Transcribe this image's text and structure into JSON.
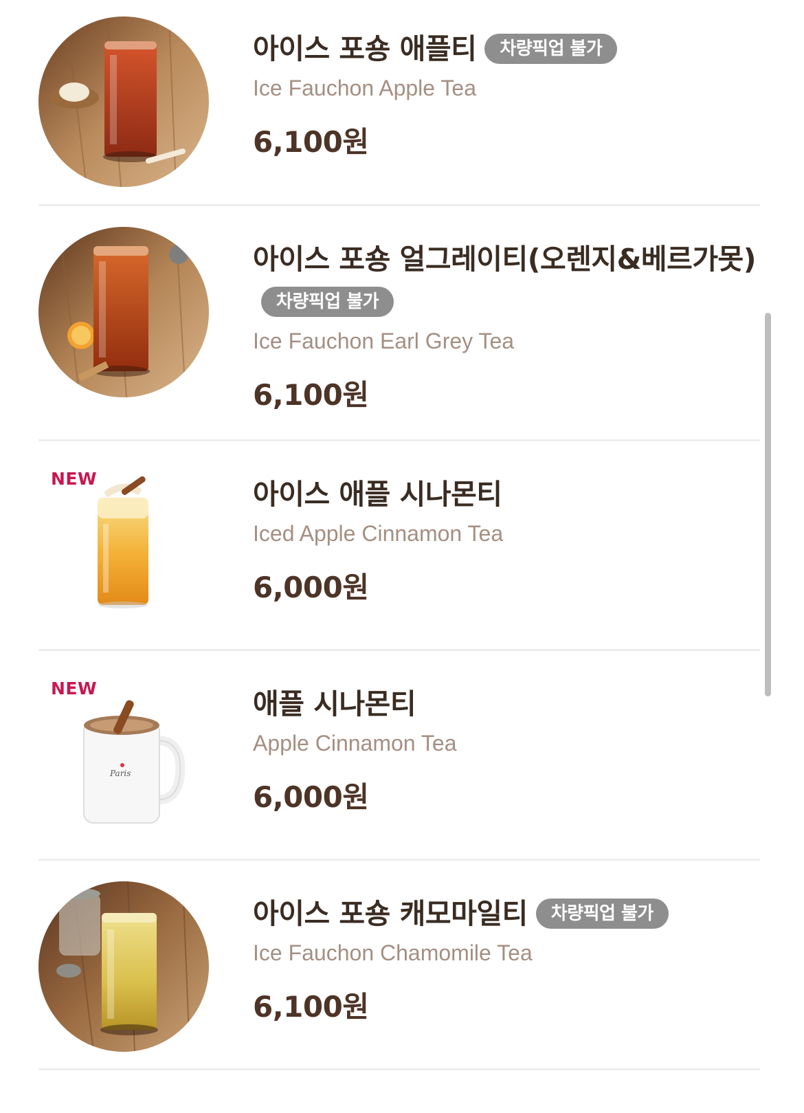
{
  "menu_items": [
    {
      "name": "아이스 포숑 애플티",
      "english_name": "Ice Fauchon Apple Tea",
      "price": "6,100원",
      "pickup_badge": "차량픽업 불가",
      "new_badge": "",
      "image": "iced-apple-tea-photo"
    },
    {
      "name": "아이스 포숑 얼그레이티(오렌지&베르가못)",
      "english_name": "Ice Fauchon Earl Grey Tea",
      "price": "6,100원",
      "pickup_badge": "차량픽업 불가",
      "new_badge": "",
      "image": "iced-earl-grey-tea-photo"
    },
    {
      "name": "아이스 애플 시나몬티",
      "english_name": "Iced Apple Cinnamon Tea",
      "price": "6,000원",
      "pickup_badge": "",
      "new_badge": "NEW",
      "image": "iced-apple-cinnamon-tea-photo"
    },
    {
      "name": "애플 시나몬티",
      "english_name": "Apple Cinnamon Tea",
      "price": "6,000원",
      "pickup_badge": "",
      "new_badge": "NEW",
      "image": "hot-apple-cinnamon-tea-mug-photo"
    },
    {
      "name": "아이스 포숑 캐모마일티",
      "english_name": "Ice Fauchon Chamomile Tea",
      "price": "6,100원",
      "pickup_badge": "차량픽업 불가",
      "new_badge": "",
      "image": "iced-chamomile-tea-photo"
    }
  ],
  "colors": {
    "name": "#3a2c22",
    "english_name": "#a48f82",
    "price": "#4d3427",
    "new_badge": "#c8174f",
    "pickup_badge_bg": "#8e8e8e",
    "divider": "#eeeeee"
  }
}
